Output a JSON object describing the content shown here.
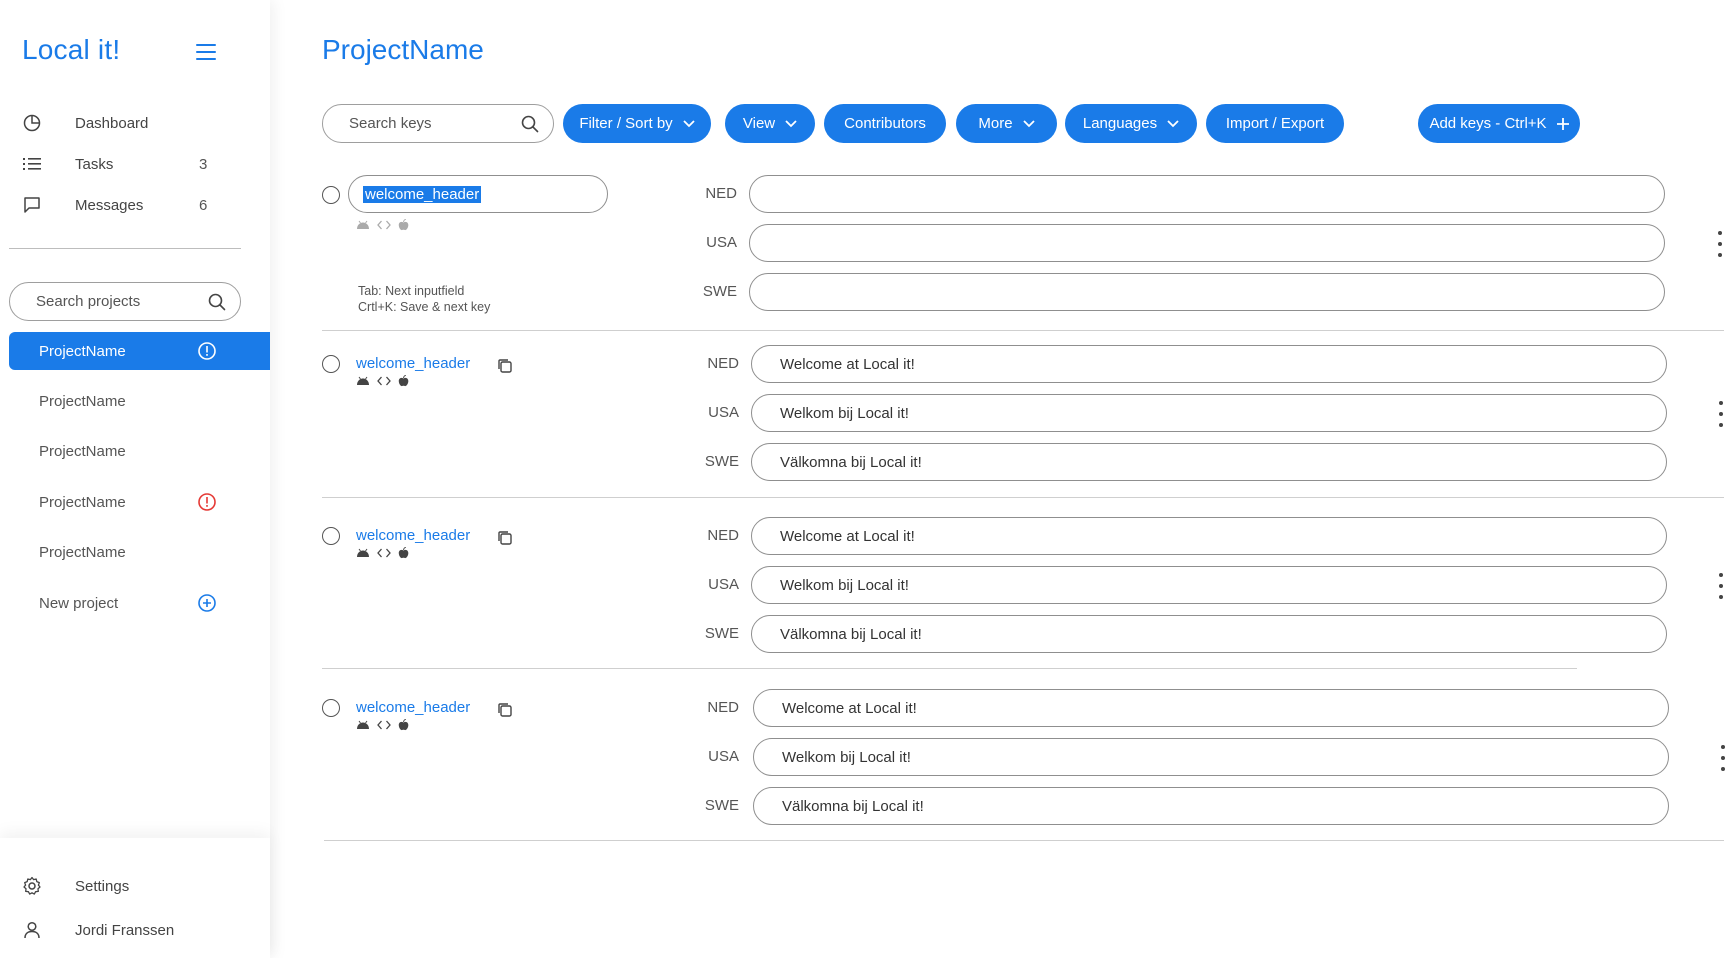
{
  "app": {
    "name": "Local it!"
  },
  "sidebar": {
    "nav": [
      {
        "label": "Dashboard",
        "count": ""
      },
      {
        "label": "Tasks",
        "count": "3"
      },
      {
        "label": "Messages",
        "count": "6"
      }
    ],
    "search_placeholder": "Search projects",
    "projects": [
      {
        "label": "ProjectName",
        "status": "warning-active"
      },
      {
        "label": "ProjectName",
        "status": ""
      },
      {
        "label": "ProjectName",
        "status": ""
      },
      {
        "label": "ProjectName",
        "status": "error"
      },
      {
        "label": "ProjectName",
        "status": ""
      }
    ],
    "new_project_label": "New project",
    "settings_label": "Settings",
    "user_name": "Jordi Franssen"
  },
  "main": {
    "title": "ProjectName",
    "search_placeholder": "Search keys",
    "toolbar": {
      "filter": "Filter / Sort by",
      "view": "View",
      "contributors": "Contributors",
      "more": "More",
      "languages": "Languages",
      "import_export": "Import / Export",
      "add_keys": "Add keys - Ctrl+K"
    },
    "editing_key": {
      "value": "welcome_header",
      "hint_line1": "Tab: Next inputfield",
      "hint_line2": "Crtl+K: Save & next key",
      "languages": [
        "NED",
        "USA",
        "SWE"
      ],
      "translations": [
        "",
        "",
        ""
      ]
    },
    "keys": [
      {
        "name": "welcome_header",
        "languages": [
          "NED",
          "USA",
          "SWE"
        ],
        "translations": [
          "Welcome at Local it!",
          "Welkom bij Local it!",
          "Välkomna bij Local it!"
        ]
      },
      {
        "name": "welcome_header",
        "languages": [
          "NED",
          "USA",
          "SWE"
        ],
        "translations": [
          "Welcome at Local it!",
          "Welkom bij Local it!",
          "Välkomna bij Local it!"
        ]
      },
      {
        "name": "welcome_header",
        "languages": [
          "NED",
          "USA",
          "SWE"
        ],
        "translations": [
          "Welcome at Local it!",
          "Welkom bij Local it!",
          "Välkomna bij Local it!"
        ]
      }
    ]
  },
  "colors": {
    "accent": "#1a7be8",
    "error": "#e53935"
  },
  "icons": [
    "menu-icon",
    "dashboard-icon",
    "tasks-icon",
    "messages-icon",
    "search-icon",
    "warning-icon",
    "add-circle-icon",
    "settings-icon",
    "user-icon",
    "chevron-down-icon",
    "plus-icon",
    "copy-icon",
    "android-icon",
    "code-icon",
    "apple-icon",
    "more-vertical-icon"
  ]
}
